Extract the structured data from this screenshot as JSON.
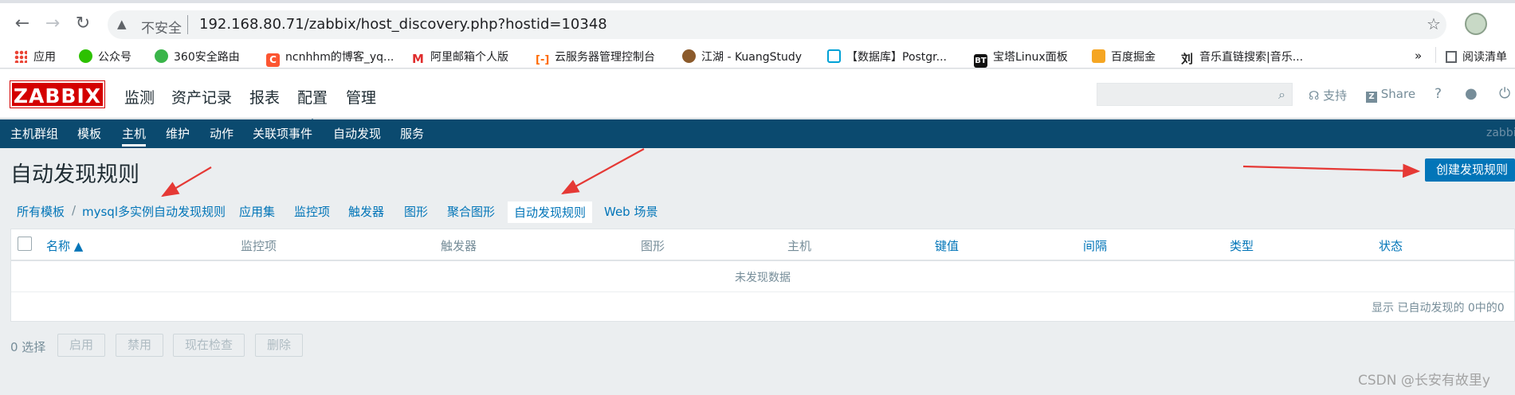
{
  "browser": {
    "insecure_label": "不安全",
    "url": "192.168.80.71/zabbix/host_discovery.php?hostid=10348",
    "bookmarks": [
      {
        "label": "应用",
        "icon": "apps-icon"
      },
      {
        "label": "公众号",
        "icon": "wechat-icon",
        "color": "#2dc100"
      },
      {
        "label": "360安全路由",
        "icon": "360-icon",
        "color": "#3ab54a"
      },
      {
        "label": "ncnhhm的博客_yq...",
        "icon": "csdn-icon",
        "color": "#fc5531"
      },
      {
        "label": "阿里邮箱个人版",
        "icon": "mail-icon",
        "color": "#e02d2d"
      },
      {
        "label": "云服务器管理控制台",
        "icon": "aliyun-icon",
        "color": "#ff6a00"
      },
      {
        "label": "江湖 - KuangStudy",
        "icon": "kuang-icon",
        "color": "#8b5a2b"
      },
      {
        "label": "【数据库】Postgr...",
        "icon": "bilibili-icon",
        "color": "#00a1d6"
      },
      {
        "label": "宝塔Linux面板",
        "icon": "bt-icon",
        "color": "#111111"
      },
      {
        "label": "百度掘金",
        "icon": "juejin-icon",
        "color": "#f5a623"
      },
      {
        "label": "音乐直链搜索|音乐...",
        "icon": "liu-icon",
        "color": "#222222"
      }
    ],
    "bookmarks_more": "»",
    "reading_list": "阅读清单"
  },
  "header": {
    "logo": "ZABBIX",
    "menu": [
      "监测",
      "资产记录",
      "报表",
      "配置",
      "管理"
    ],
    "active_menu": "配置",
    "support": "支持",
    "share": "Share",
    "help": "?"
  },
  "subnav": {
    "items": [
      "主机群组",
      "模板",
      "主机",
      "维护",
      "动作",
      "关联项事件",
      "自动发现",
      "服务"
    ],
    "active": "主机",
    "right_text": "zabbi"
  },
  "page": {
    "title": "自动发现规则",
    "create_button": "创建发现规则"
  },
  "breadcrumbs": {
    "all_templates": "所有模板",
    "separator": "/",
    "template": "mysql多实例自动发现规则",
    "tabs": [
      "应用集",
      "监控项",
      "触发器",
      "图形",
      "聚合图形",
      "自动发现规则",
      "Web 场景"
    ],
    "active_tab": "自动发现规则"
  },
  "table": {
    "columns": [
      "名称 ▲",
      "监控项",
      "触发器",
      "图形",
      "主机",
      "键值",
      "间隔",
      "类型",
      "状态"
    ],
    "empty_text": "未发现数据",
    "footer": "显示 已自动发现的 0中的0"
  },
  "actions": {
    "selected": "0 选择",
    "buttons": [
      "启用",
      "禁用",
      "现在检查",
      "删除"
    ]
  },
  "watermark": "CSDN @长安有故里y",
  "colors": {
    "brand_red": "#d40000",
    "nav_blue": "#0b4a6f",
    "link_blue": "#0275b8",
    "annotation_arrow": "#e53935"
  }
}
